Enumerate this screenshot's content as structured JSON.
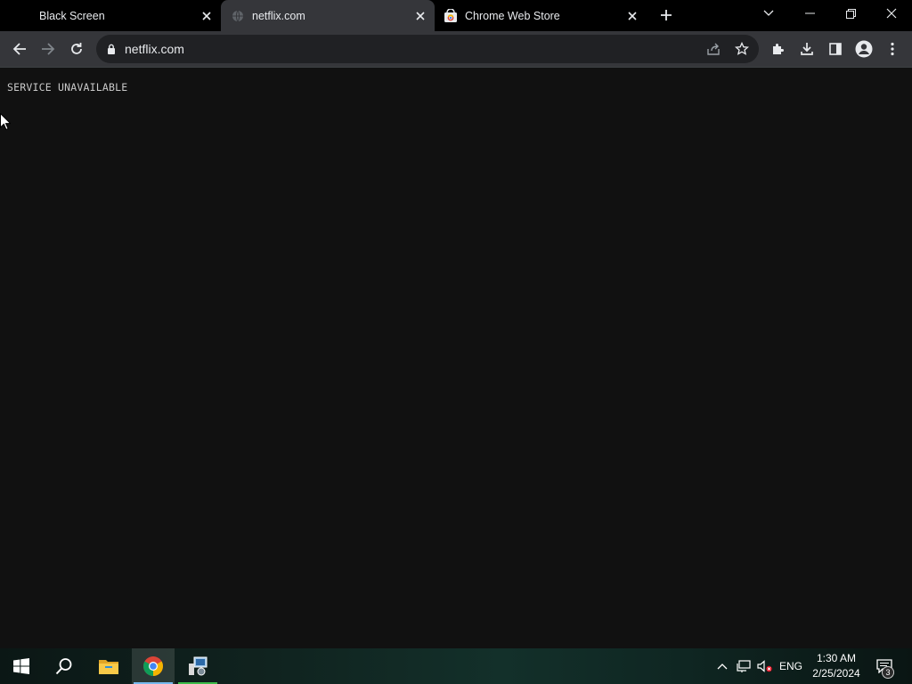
{
  "browser": {
    "tabs": [
      {
        "title": "Black Screen",
        "favicon": "none",
        "active": false
      },
      {
        "title": "netflix.com",
        "favicon": "globe-icon",
        "active": true
      },
      {
        "title": "Chrome Web Store",
        "favicon": "chrome-web-store-icon",
        "active": false
      }
    ],
    "address_bar": {
      "url": "netflix.com",
      "security_icon": "lock-icon"
    },
    "toolbar_icons": [
      "back-icon",
      "forward-icon",
      "reload-icon",
      "share-icon",
      "bookmark-star-icon",
      "extensions-icon",
      "download-icon",
      "side-panel-icon",
      "profile-icon",
      "menu-icon"
    ],
    "window_controls": [
      "tab-search-icon",
      "minimize-icon",
      "restore-icon",
      "close-icon"
    ]
  },
  "page": {
    "message": "SERVICE UNAVAILABLE"
  },
  "taskbar": {
    "pinned": [
      "start-icon",
      "search-icon",
      "file-explorer-icon",
      "chrome-icon",
      "app-icon"
    ],
    "tray": {
      "language": "ENG",
      "time": "1:30 AM",
      "date": "2/25/2024",
      "notifications_count": "3"
    }
  },
  "colors": {
    "page_bg": "#111111",
    "tabstrip_bg": "#000000",
    "toolbar_bg": "#35363a",
    "omnibox_bg": "#202124",
    "taskbar_accent": "#76b9ed"
  }
}
